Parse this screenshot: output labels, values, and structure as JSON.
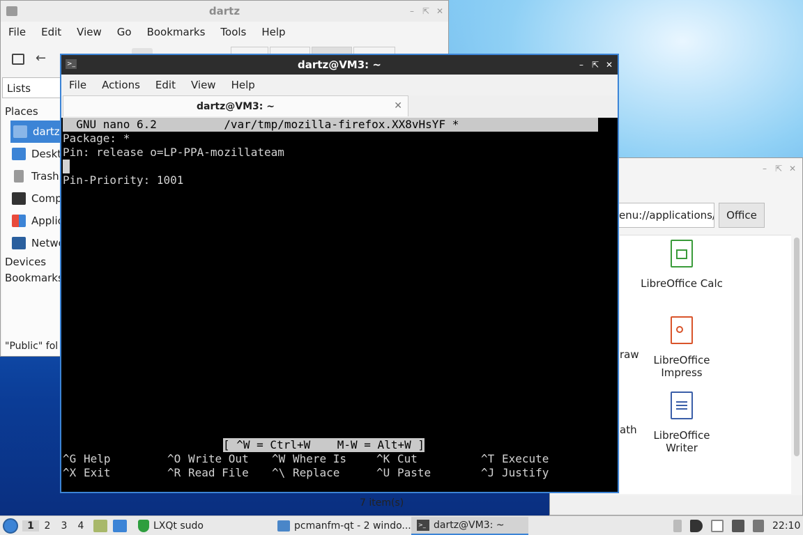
{
  "file_manager": {
    "title": "dartz",
    "menu": [
      "File",
      "Edit",
      "View",
      "Go",
      "Bookmarks",
      "Tools",
      "Help"
    ],
    "side_tab": "Lists",
    "places_label": "Places",
    "places": [
      "dartz",
      "Deskt",
      "Trash",
      "Comp",
      "Applic",
      "Netwo"
    ],
    "devices_label": "Devices",
    "bookmarks_label": "Bookmarks",
    "status": "\"Public\" fol"
  },
  "apps_window": {
    "path": "enu://applications/",
    "office_tab": "Office",
    "items": [
      {
        "label": "LibreOffice Calc",
        "icon": "spreadsheet-icon",
        "color": "#3a9b3a"
      },
      {
        "label": "LibreOffice Impress",
        "icon": "presentation-icon",
        "color": "#d9542a"
      },
      {
        "label": "LibreOffice Writer",
        "icon": "document-icon",
        "color": "#3a5ea8"
      }
    ],
    "partial_labels": [
      "raw",
      "ath"
    ],
    "status": "7 item(s)"
  },
  "terminal": {
    "title": "dartz@VM3: ~",
    "menu": [
      "File",
      "Actions",
      "Edit",
      "View",
      "Help"
    ],
    "tab_label": "dartz@VM3: ~",
    "nano": {
      "header": "  GNU nano 6.2          /var/tmp/mozilla-firefox.XX8vHsYF *",
      "lines": [
        "Package: *",
        "Pin: release o=LP-PPA-mozillateam",
        "",
        "Pin-Priority: 1001"
      ],
      "hint": "[ ^W = Ctrl+W    M-W = Alt+W ]",
      "shortcuts_row1": [
        {
          "key": "^G",
          "label": "Help"
        },
        {
          "key": "^O",
          "label": "Write Out"
        },
        {
          "key": "^W",
          "label": "Where Is"
        },
        {
          "key": "^K",
          "label": "Cut"
        },
        {
          "key": "^T",
          "label": "Execute"
        }
      ],
      "shortcuts_row2": [
        {
          "key": "^X",
          "label": "Exit"
        },
        {
          "key": "^R",
          "label": "Read File"
        },
        {
          "key": "^\\",
          "label": "Replace"
        },
        {
          "key": "^U",
          "label": "Paste"
        },
        {
          "key": "^J",
          "label": "Justify"
        }
      ]
    }
  },
  "taskbar": {
    "workspaces": [
      "1",
      "2",
      "3",
      "4"
    ],
    "tasks": [
      "LXQt sudo",
      "pcmanfm-qt - 2 windo...",
      "dartz@VM3: ~"
    ],
    "clock": "22:10"
  },
  "colors": {
    "accent": "#3c84d6",
    "terminal_bg": "#000000",
    "terminal_fg": "#d3d3d3",
    "nano_bar": "#c9c9c9"
  }
}
